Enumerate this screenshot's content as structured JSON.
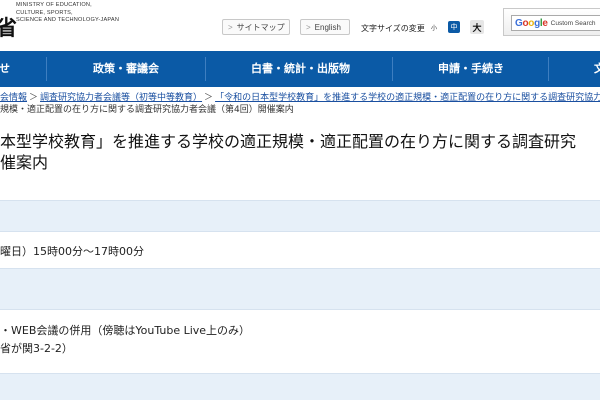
{
  "header": {
    "logo_kanji": "省",
    "logo_en_lines": [
      "MINISTRY OF EDUCATION,",
      "CULTURE, SPORTS,",
      "SCIENCE AND TECHNOLOGY-JAPAN"
    ],
    "sitemap_label": "サイトマップ",
    "english_label": "English",
    "fontsize_label": "文字サイズの変更",
    "fontsize_small": "小",
    "fontsize_mid": "中",
    "fontsize_large": "大",
    "search_brand": "Google",
    "search_placeholder": "Custom Search"
  },
  "nav": {
    "items": [
      "せ",
      "政策・審議会",
      "白書・統計・出版物",
      "申請・手続き",
      "文"
    ]
  },
  "breadcrumb": {
    "items": [
      "会情報",
      "調査研究協力者会議等（初等中等教育）",
      "「令和の日本型学校教育」を推進する学校の適正規模・適正配置の在り方に関する調査研究協力者"
    ],
    "separator": "＞",
    "line2": "規模・適正配置の在り方に関する調査研究協力者会議（第4回）開催案内"
  },
  "title": {
    "line1": "本型学校教育」を推進する学校の適正規模・適正配置の在り方に関する調査研究",
    "line2": "催案内"
  },
  "content": {
    "datetime": "曜日）15時00分～17時00分",
    "venue_line1": "・WEB会議の併用（傍聴はYouTube Live上のみ）",
    "venue_line2": "省が関3-2-2）"
  },
  "colors": {
    "nav_bg": "#0b5aa6",
    "band_bg": "#e7f0f9",
    "link": "#1a4fa0"
  }
}
